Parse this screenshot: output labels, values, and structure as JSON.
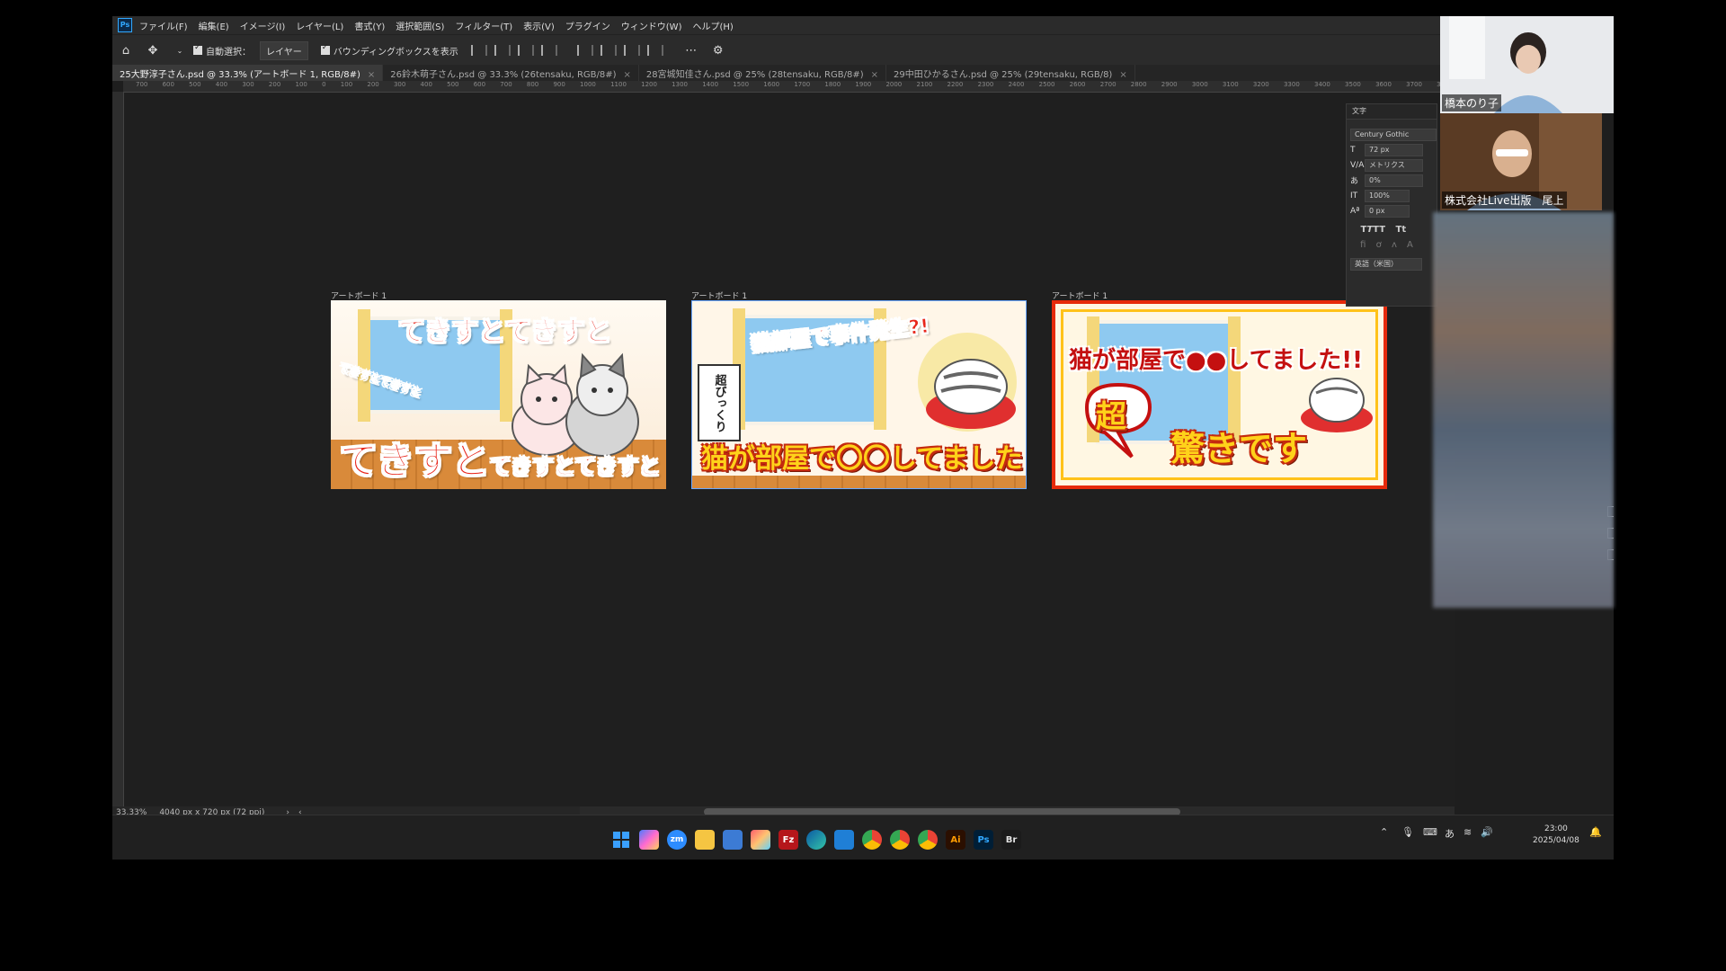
{
  "menu": [
    "ファイル(F)",
    "編集(E)",
    "イメージ(I)",
    "レイヤー(L)",
    "書式(Y)",
    "選択範囲(S)",
    "フィルター(T)",
    "表示(V)",
    "プラグイン",
    "ウィンドウ(W)",
    "ヘルプ(H)"
  ],
  "options": {
    "auto_select_label": "自動選択：",
    "auto_select_target": "レイヤー",
    "bounding_box_label": "バウンディングボックスを表示"
  },
  "tabs": [
    {
      "label": "25大野淳子さん.psd @ 33.3% (アートボード 1, RGB/8#)",
      "active": true
    },
    {
      "label": "26鈴木萌子さん.psd @ 33.3% (26tensaku, RGB/8#)",
      "active": false
    },
    {
      "label": "28宮城知佳さん.psd @ 25% (28tensaku, RGB/8#)",
      "active": false
    },
    {
      "label": "29中田ひかるさん.psd @ 25% (29tensaku, RGB/8)",
      "active": false
    }
  ],
  "ruler_top": "700 600 500 400 300 200 100 0 100 200 300 400 500 600 700 800 900 1000 1100 1200 1300 1400 1500 1600 1700 1800 1900 2000 2100 2200 2300 2400 2500 2600 2700 2800 2900 3000 3100 3200 3300 3400 3500 3600 3700 3800",
  "artboards": [
    {
      "label": "アートボード 1",
      "title": "てきすとてきすと",
      "side": "てきすとてきすと",
      "bottom_big": "てきすと",
      "bottom_small": "てきすとてきすと"
    },
    {
      "label": "アートボード 1",
      "title": "猫部屋で事件発生?!",
      "tag": "超びっくり",
      "bottom": "猫が部屋で〇〇してました"
    },
    {
      "label": "アートボード 1",
      "title": "猫が部屋で●●してました!!",
      "bubble": "超",
      "sub": "驚きです"
    }
  ],
  "status": {
    "zoom": "33.33%",
    "size": "4040 px x 720 px (72 ppi)"
  },
  "char_panel": {
    "title": "文字",
    "font": "Century Gothic",
    "size": "72 px",
    "kerning": "メトリクス",
    "tracking": "0%",
    "scale": "100%",
    "baseline": "0 px",
    "lang": "英語（米国）"
  },
  "participants": [
    {
      "name": "橋本のり子"
    },
    {
      "name": "株式会社Live出版　尾上"
    }
  ],
  "clock": {
    "time": "23:00",
    "date": "2025/04/08"
  },
  "taskbar_icons": [
    "start-icon",
    "copilot-icon",
    "zoom-icon",
    "file-explorer-icon",
    "notepad-icon",
    "photos-icon",
    "filezilla-icon",
    "edge-icon",
    "vscode-icon",
    "chrome-icon",
    "chrome-icon-2",
    "chrome-icon-3",
    "illustrator-icon",
    "photoshop-icon",
    "bridge-icon"
  ],
  "taskbar_labels": {
    "zoom": "zm",
    "ai": "Ai",
    "ps": "Ps",
    "br": "Br",
    "fz": "Fz"
  }
}
